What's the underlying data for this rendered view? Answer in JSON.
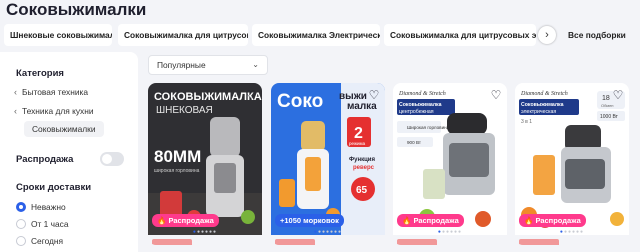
{
  "page": {
    "title": "Соковыжималки"
  },
  "chips": {
    "items": [
      "Шнековые соковыжималки",
      "Соковыжималка для цитрусовых",
      "Соковыжималка Электрическая",
      "Соковыжималка для цитрусовых электри"
    ],
    "more_label": "Все подборки"
  },
  "sidebar": {
    "category_heading": "Категория",
    "categories": [
      "Бытовая техника",
      "Техника для кухни",
      "Соковыжималки"
    ],
    "sale_label": "Распродажа",
    "delivery_heading": "Сроки доставки",
    "delivery_options": [
      "Неважно",
      "От 1 часа",
      "Сегодня"
    ],
    "delivery_selected": "Неважно"
  },
  "sort": {
    "selected": "Популярные"
  },
  "products": [
    {
      "badge": "Распродажа",
      "image_text": [
        "СОКОВЫЖИМАЛКА",
        "ШНЕКОВАЯ",
        "80MM",
        "широкая горловина"
      ],
      "bg_color": "#2f2f33"
    },
    {
      "badge": "+1050 морковок",
      "image_text": [
        "Соко",
        "выжи",
        "малка",
        "2",
        "режима",
        "Функция",
        "реверс",
        "65"
      ],
      "bg_color": "#2c6fe0"
    },
    {
      "badge": "Распродажа",
      "image_text": [
        "Diamond & Stretch",
        "Соковыжималка",
        "центробежная",
        "Широкая горловина",
        "900 Вт"
      ],
      "bg_color": "#ffffff"
    },
    {
      "badge": "Распродажа",
      "image_text": [
        "Diamond & Stretch",
        "Соковыжималка",
        "электрическая",
        "3 в 1",
        "18",
        "Обмен",
        "1000 Вт"
      ],
      "bg_color": "#ffffff"
    }
  ]
}
